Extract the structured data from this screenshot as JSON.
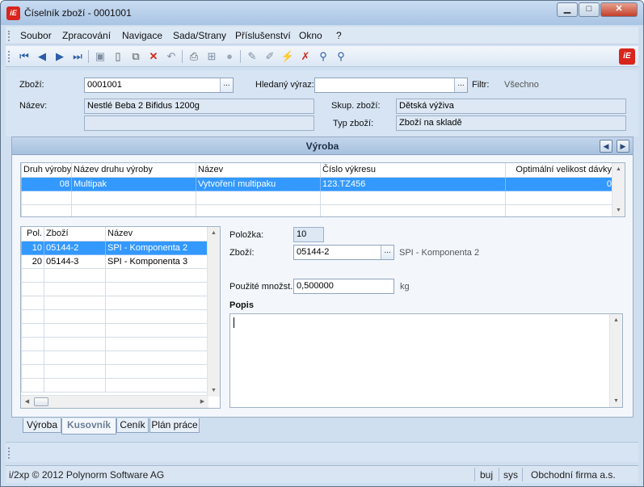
{
  "window": {
    "title": "Číselník zboží - 0001001",
    "logo_text": "iE"
  },
  "menu": [
    "Soubor",
    "Zpracování",
    "Navigace",
    "Sada/Strany",
    "Příslušenství",
    "Okno",
    "?"
  ],
  "header": {
    "zbozi_label": "Zboží:",
    "zbozi_value": "0001001",
    "hledany_label": "Hledaný výraz:",
    "hledany_value": "",
    "filtr_label": "Filtr:",
    "filtr_value": "Všechno",
    "nazev_label": "Název:",
    "nazev_value": "Nestlé Beba 2 Bifidus 1200g",
    "nazev_value2": "",
    "skup_label": "Skup. zboží:",
    "skup_value": "Dětská výživa",
    "typ_label": "Typ zboží:",
    "typ_value": "Zboží na skladě"
  },
  "section": {
    "title": "Výroba"
  },
  "production_table": {
    "columns": [
      "Druh výroby",
      "Název druhu výroby",
      "Název",
      "Číslo výkresu",
      "Optimální velikost dávky"
    ],
    "rows": [
      [
        "08",
        "Multipak",
        "Vytvoření multipaku",
        "123.TZ456",
        "0"
      ]
    ]
  },
  "components_table": {
    "columns": [
      "Pol.",
      "Zboží",
      "Název"
    ],
    "rows": [
      [
        "10",
        "05144-2",
        "SPI - Komponenta 2"
      ],
      [
        "20",
        "05144-3",
        "SPI - Komponenta 3"
      ]
    ]
  },
  "detail": {
    "polozka_label": "Položka:",
    "polozka_value": "10",
    "zbozi_label": "Zboží:",
    "zbozi_value": "05144-2",
    "zbozi_name": "SPI - Komponenta 2",
    "mnozstvi_label": "Použité množst.:",
    "mnozstvi_value": "0,500000",
    "mnozstvi_unit": "kg",
    "popis_label": "Popis",
    "popis_value": ""
  },
  "tabs": [
    "Výroba",
    "Kusovník",
    "Ceník",
    "Plán práce"
  ],
  "status": {
    "copyright": "i/2xp © 2012 Polynorm Software AG",
    "user": "buj",
    "db": "sys",
    "company": "Obchodní firma a.s."
  },
  "ellipsis": "..."
}
